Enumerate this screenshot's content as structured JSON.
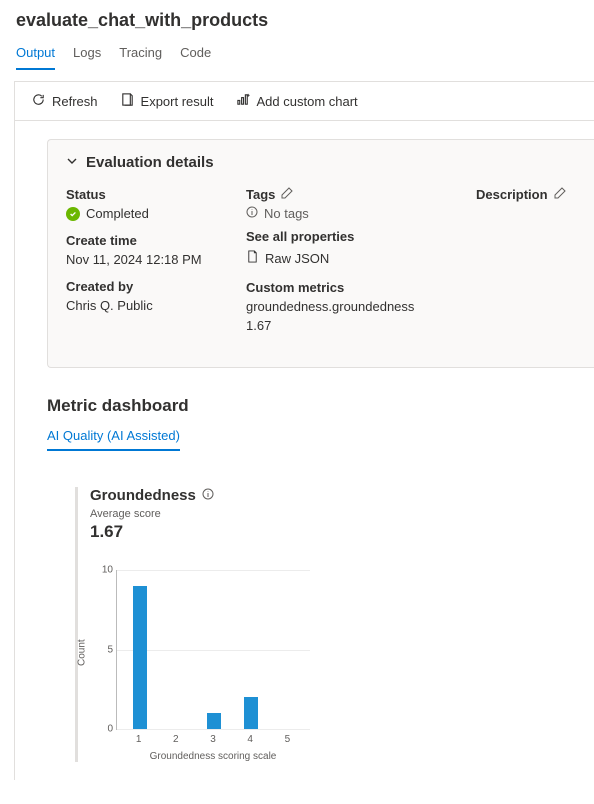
{
  "page_title": "evaluate_chat_with_products",
  "tabs": [
    "Output",
    "Logs",
    "Tracing",
    "Code"
  ],
  "active_tab": 0,
  "toolbar": {
    "refresh": "Refresh",
    "export": "Export result",
    "add_chart": "Add custom chart"
  },
  "details": {
    "header": "Evaluation details",
    "status_label": "Status",
    "status_value": "Completed",
    "create_time_label": "Create time",
    "create_time_value": "Nov 11, 2024 12:18 PM",
    "created_by_label": "Created by",
    "created_by_value": "Chris Q. Public",
    "tags_label": "Tags",
    "no_tags": "No tags",
    "see_all_props": "See all properties",
    "raw_json": "Raw JSON",
    "custom_metrics_label": "Custom metrics",
    "custom_metrics_name": "groundedness.groundedness",
    "custom_metrics_value": "1.67",
    "description_label": "Description"
  },
  "metric_dashboard": {
    "title": "Metric dashboard",
    "tab": "AI Quality (AI Assisted)"
  },
  "chart": {
    "title": "Groundedness",
    "avg_label": "Average score",
    "avg_value": "1.67"
  },
  "chart_data": {
    "type": "bar",
    "title": "Groundedness",
    "categories": [
      "1",
      "2",
      "3",
      "4",
      "5"
    ],
    "values": [
      9,
      0,
      1,
      2,
      0
    ],
    "xlabel": "Groundedness scoring scale",
    "ylabel": "Count",
    "ylim": [
      0,
      10
    ],
    "yticks": [
      0,
      5,
      10
    ]
  }
}
